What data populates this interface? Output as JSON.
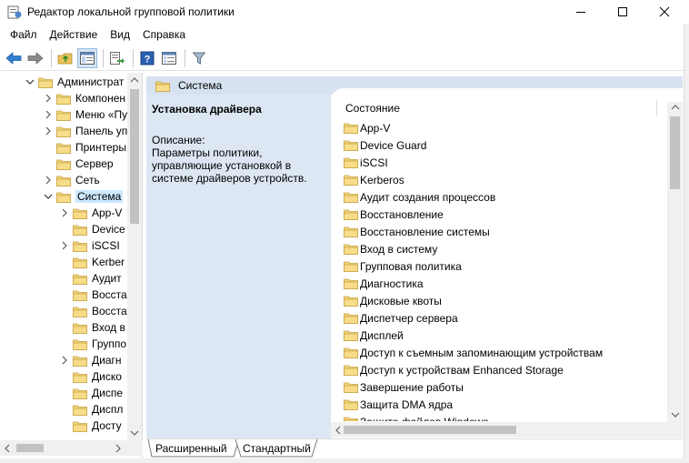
{
  "window": {
    "title": "Редактор локальной групповой политики"
  },
  "menu": [
    "Файл",
    "Действие",
    "Вид",
    "Справка"
  ],
  "toolbar": [
    "back-icon",
    "forward-icon",
    "up-folder-icon",
    "show-hide-tree-icon",
    "export-list-icon",
    "help-icon",
    "properties-icon",
    "filter-icon"
  ],
  "tree": {
    "items": [
      {
        "label": "Администрат",
        "expander": "expanded",
        "level": 0
      },
      {
        "label": "Компонен",
        "expander": "collapsed",
        "level": 1
      },
      {
        "label": "Меню «Пу",
        "expander": "collapsed",
        "level": 1
      },
      {
        "label": "Панель уп",
        "expander": "collapsed",
        "level": 1
      },
      {
        "label": "Принтеры",
        "expander": "none",
        "level": 1
      },
      {
        "label": "Сервер",
        "expander": "none",
        "level": 1
      },
      {
        "label": "Сеть",
        "expander": "collapsed",
        "level": 1
      },
      {
        "label": "Система",
        "expander": "expanded",
        "level": 1,
        "selected": true
      },
      {
        "label": "App-V",
        "expander": "collapsed",
        "level": 2
      },
      {
        "label": "Device",
        "expander": "none",
        "level": 2
      },
      {
        "label": "iSCSI",
        "expander": "collapsed",
        "level": 2
      },
      {
        "label": "Kerber",
        "expander": "none",
        "level": 2
      },
      {
        "label": "Аудит",
        "expander": "none",
        "level": 2
      },
      {
        "label": "Восста",
        "expander": "none",
        "level": 2
      },
      {
        "label": "Восста",
        "expander": "none",
        "level": 2
      },
      {
        "label": "Вход в",
        "expander": "none",
        "level": 2
      },
      {
        "label": "Группо",
        "expander": "none",
        "level": 2
      },
      {
        "label": "Диагн",
        "expander": "collapsed",
        "level": 2
      },
      {
        "label": "Диско",
        "expander": "none",
        "level": 2
      },
      {
        "label": "Диспе",
        "expander": "none",
        "level": 2
      },
      {
        "label": "Диспл",
        "expander": "none",
        "level": 2
      },
      {
        "label": "Досту",
        "expander": "none",
        "level": 2
      }
    ]
  },
  "content": {
    "header": "Система",
    "description": {
      "title": "Установка драйвера",
      "label": "Описание:",
      "text": "Параметры политики, управляющие установкой в системе драйверов устройств."
    },
    "column_header": "Состояние",
    "items": [
      "App-V",
      "Device Guard",
      "iSCSI",
      "Kerberos",
      "Аудит создания процессов",
      "Восстановление",
      "Восстановление системы",
      "Вход в систему",
      "Групповая политика",
      "Диагностика",
      "Дисковые квоты",
      "Диспетчер сервера",
      "Дисплей",
      "Доступ к съемным запоминающим устройствам",
      "Доступ к устройствам Enhanced Storage",
      "Завершение работы",
      "Защита DMA ядра",
      "Защита файлов Windows"
    ]
  },
  "tabs": {
    "extended": "Расширенный",
    "standard": "Стандартный"
  }
}
